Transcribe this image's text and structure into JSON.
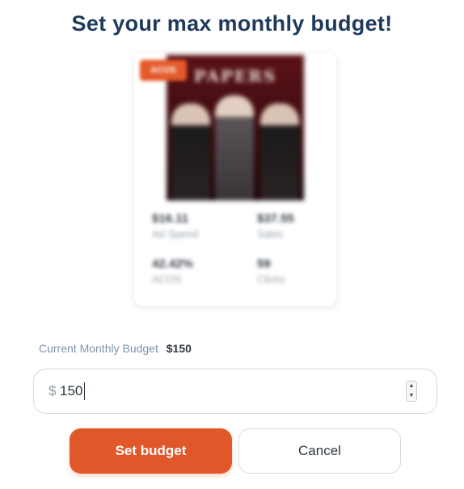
{
  "modal": {
    "title": "Set your max monthly budget!"
  },
  "product_card": {
    "badge": "ACOS",
    "cover_title": "PAPERS",
    "stats": [
      {
        "value": "$16.11",
        "label": "Ad Spend"
      },
      {
        "value": "$37.55",
        "label": "Sales"
      },
      {
        "value": "42.42%",
        "label": "ACOS"
      },
      {
        "value": "59",
        "label": "Clicks"
      }
    ]
  },
  "budget": {
    "label": "Current Monthly Budget",
    "current_value": "$150",
    "currency_symbol": "$",
    "input_value": "150"
  },
  "actions": {
    "set_label": "Set budget",
    "cancel_label": "Cancel"
  },
  "colors": {
    "title": "#1f3a5c",
    "accent": "#e0582a",
    "muted_label": "#7e93aa"
  },
  "icons": {
    "spinner_up": "chevron-up-icon",
    "spinner_down": "chevron-down-icon"
  }
}
